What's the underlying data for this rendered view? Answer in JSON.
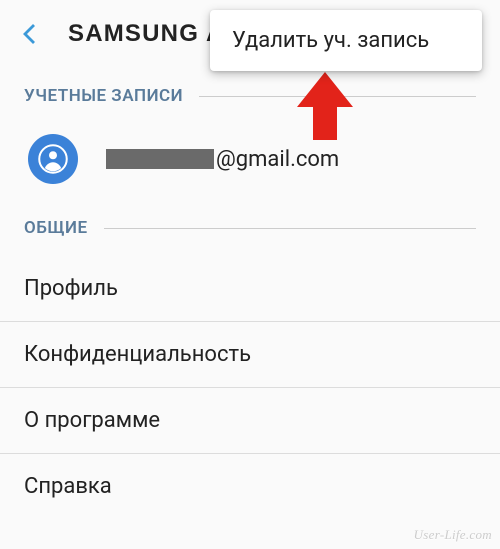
{
  "header": {
    "title": "SAMSUNG ACC"
  },
  "popup": {
    "delete_label": "Удалить уч. запись"
  },
  "sections": {
    "accounts_label": "УЧЕТНЫЕ ЗАПИСИ",
    "general_label": "ОБЩИЕ"
  },
  "account": {
    "email_suffix": "@gmail.com"
  },
  "menu": {
    "profile": "Профиль",
    "privacy": "Конфиденциальность",
    "about": "О программе",
    "help": "Справка"
  },
  "watermark": "User-Life.com",
  "arrow": {
    "color": "#e2231a"
  }
}
